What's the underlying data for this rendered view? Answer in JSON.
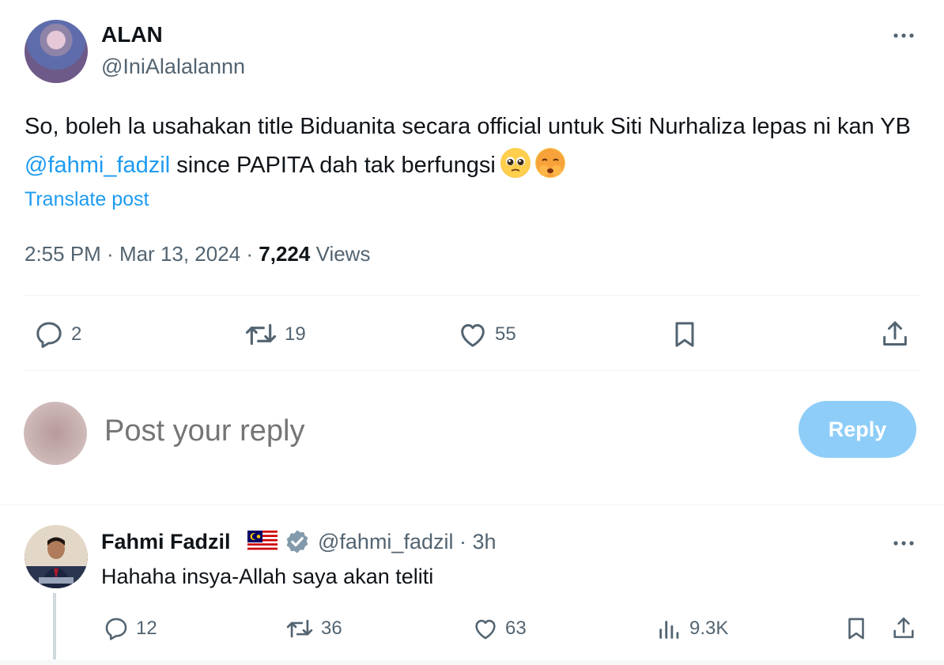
{
  "tweet": {
    "author_name": "ALAN",
    "author_handle": "@IniAlalalannn",
    "text_before": "So, boleh la usahakan title Biduanita secara official untuk Siti Nurhaliza lepas ni kan YB ",
    "mention": "@fahmi_fadzil",
    "text_after": " since PAPITA dah tak berfungsi",
    "translate": "Translate post",
    "time": "2:55 PM",
    "date": "Mar 13, 2024",
    "views": "7,224",
    "views_label": "Views",
    "stats": {
      "replies": "2",
      "reposts": "19",
      "likes": "55"
    }
  },
  "reply_box": {
    "placeholder": "Post your reply",
    "button": "Reply"
  },
  "reply": {
    "author_name": "Fahmi Fadzil",
    "author_handle": "@fahmi_fadzil",
    "time": "3h",
    "text": "Hahaha insya-Allah saya akan teliti",
    "stats": {
      "replies": "12",
      "reposts": "36",
      "likes": "63",
      "views": "9.3K"
    }
  },
  "colors": {
    "accent": "#1d9bf0",
    "secondary_text": "#536471",
    "reply_button_disabled": "#8ecdf8",
    "verified_badge": "#829aab"
  },
  "icons": [
    "more-icon",
    "reply-icon",
    "repost-icon",
    "like-icon",
    "bookmark-icon",
    "share-icon",
    "views-icon",
    "verified-icon",
    "malaysia-flag-icon"
  ]
}
